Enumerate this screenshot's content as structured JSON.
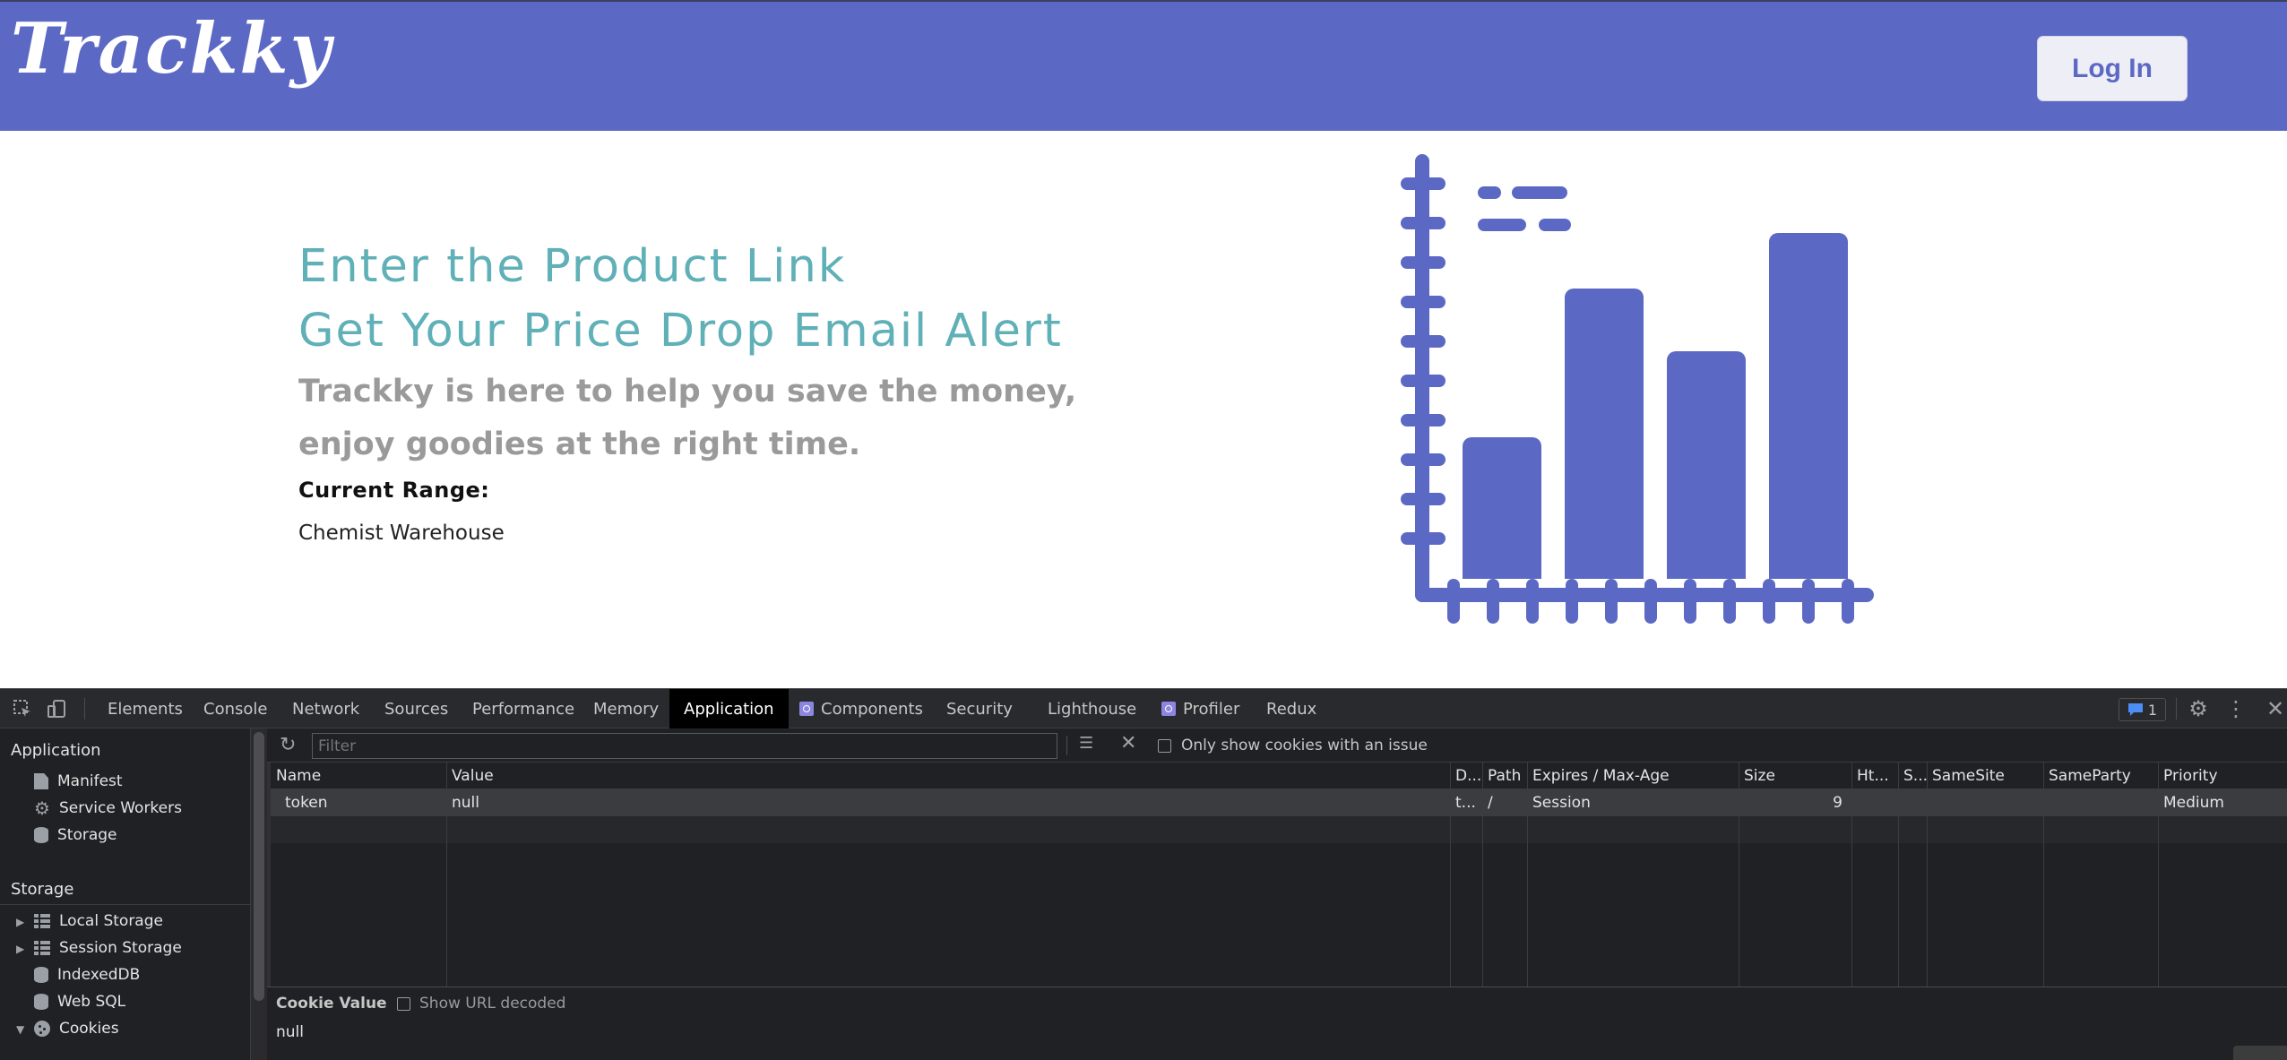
{
  "app": {
    "logo": "Trackky",
    "login_label": "Log In",
    "brand_color": "#5c69c4"
  },
  "hero": {
    "headline_line1": "Enter the Product Link",
    "headline_line2": "Get Your Price Drop Email Alert",
    "tagline_line1": "Trackky is here to help you save the money,",
    "tagline_line2": "enjoy goodies at the right time.",
    "range_label": "Current Range:",
    "range_value": "Chemist Warehouse",
    "illustration_icon": "bar-chart-icon"
  },
  "devtools": {
    "tabs": [
      {
        "label": "Elements"
      },
      {
        "label": "Console"
      },
      {
        "label": "Network"
      },
      {
        "label": "Sources"
      },
      {
        "label": "Performance"
      },
      {
        "label": "Memory"
      },
      {
        "label": "Application"
      },
      {
        "label": "Components"
      },
      {
        "label": "Security"
      },
      {
        "label": "Lighthouse"
      },
      {
        "label": "Profiler"
      },
      {
        "label": "Redux"
      }
    ],
    "active_tab": "Application",
    "issues_count": "1",
    "sidebar": {
      "application_heading": "Application",
      "application_items": [
        "Manifest",
        "Service Workers",
        "Storage"
      ],
      "storage_heading": "Storage",
      "storage_items": [
        "Local Storage",
        "Session Storage",
        "IndexedDB",
        "Web SQL",
        "Cookies"
      ]
    },
    "toolbar": {
      "filter_placeholder": "Filter",
      "only_issues_label": "Only show cookies with an issue"
    },
    "columns": [
      "Name",
      "Value",
      "D...",
      "Path",
      "Expires / Max-Age",
      "Size",
      "Ht...",
      "S...",
      "SameSite",
      "SameParty",
      "Priority"
    ],
    "rows": [
      {
        "name": "token",
        "value": "null",
        "domain": "t...",
        "path": "/",
        "expires": "Session",
        "size": "9",
        "httponly": "",
        "secure": "",
        "samesite": "",
        "sameparty": "",
        "priority": "Medium"
      }
    ],
    "cookie_value_title": "Cookie Value",
    "show_url_decoded_label": "Show URL decoded",
    "cookie_value": "null"
  }
}
